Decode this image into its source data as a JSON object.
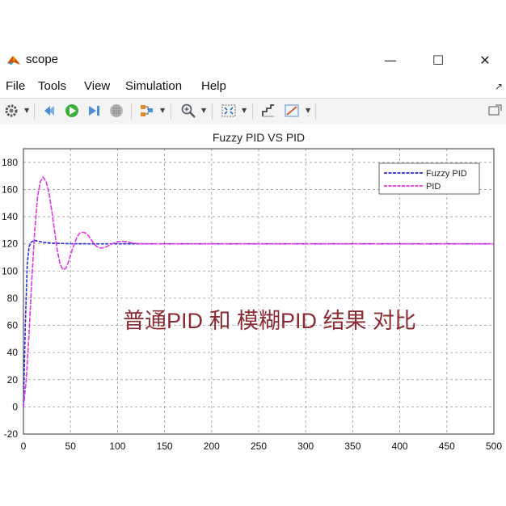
{
  "window": {
    "title": "scope"
  },
  "menu": [
    "File",
    "Tools",
    "View",
    "Simulation",
    "Help"
  ],
  "toolbar": [
    "settings-icon",
    "restore-icon",
    "run-icon",
    "step-forward-icon",
    "highlight-block-icon",
    "layout-icon",
    "zoom-icon",
    "autoscale-icon",
    "cursor-measure-icon",
    "style-icon"
  ],
  "annotation": "普通PID 和 模糊PID 结果  对比",
  "chart_data": {
    "type": "line",
    "title": "Fuzzy PID VS PID",
    "xlabel": "",
    "ylabel": "",
    "xlim": [
      0,
      500
    ],
    "ylim": [
      -20,
      190
    ],
    "xticks": [
      0,
      50,
      100,
      150,
      200,
      250,
      300,
      350,
      400,
      450,
      500
    ],
    "yticks": [
      -20,
      0,
      20,
      40,
      60,
      80,
      100,
      120,
      140,
      160,
      180
    ],
    "grid": true,
    "legend": "top-right",
    "series": [
      {
        "name": "Fuzzy PID",
        "color": "#2b2bd6",
        "x": [
          0,
          2,
          4,
          6,
          8,
          10,
          12,
          15,
          20,
          30,
          50,
          80,
          120,
          200,
          500
        ],
        "y": [
          0,
          60,
          105,
          118,
          121,
          122,
          122.5,
          122,
          121.3,
          120.5,
          120.1,
          120,
          120,
          120,
          120
        ]
      },
      {
        "name": "PID",
        "color": "#e234e2",
        "x": [
          0,
          3,
          6,
          9,
          12,
          15,
          18,
          21,
          24,
          27,
          30,
          33,
          36,
          39,
          42,
          45,
          48,
          51,
          54,
          57,
          60,
          63,
          66,
          69,
          72,
          75,
          78,
          81,
          84,
          87,
          90,
          95,
          100,
          105,
          110,
          115,
          120,
          130,
          140,
          150,
          200,
          500
        ],
        "y": [
          0,
          20,
          55,
          95,
          130,
          155,
          166,
          169,
          166,
          158,
          145,
          130,
          115,
          105,
          101,
          102,
          107,
          114,
          120,
          125,
          128,
          128.5,
          128,
          126,
          123,
          120,
          118,
          117,
          117,
          117.5,
          118.5,
          120.3,
          121.5,
          121.8,
          121.4,
          120.8,
          120.3,
          120,
          120,
          120,
          120,
          120
        ]
      }
    ]
  }
}
